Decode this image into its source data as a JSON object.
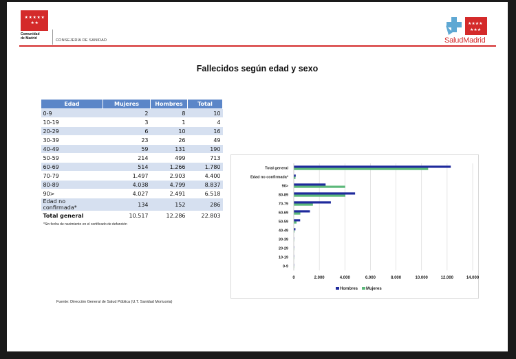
{
  "header": {
    "logo_left_line1": "Comunidad",
    "logo_left_line2": "de Madrid",
    "consejeria": "CONSEJERÍA DE SANIDAD",
    "logo_right": "SaludMadrid"
  },
  "title": "Fallecidos según edad y sexo",
  "table": {
    "headers": [
      "Edad",
      "Mujeres",
      "Hombres",
      "Total"
    ],
    "rows": [
      [
        "0-9",
        "2",
        "8",
        "10"
      ],
      [
        "10-19",
        "3",
        "1",
        "4"
      ],
      [
        "20-29",
        "6",
        "10",
        "16"
      ],
      [
        "30-39",
        "23",
        "26",
        "49"
      ],
      [
        "40-49",
        "59",
        "131",
        "190"
      ],
      [
        "50-59",
        "214",
        "499",
        "713"
      ],
      [
        "60-69",
        "514",
        "1.266",
        "1.780"
      ],
      [
        "70-79",
        "1.497",
        "2.903",
        "4.400"
      ],
      [
        "80-89",
        "4.038",
        "4.799",
        "8.837"
      ],
      [
        "90>",
        "4.027",
        "2.491",
        "6.518"
      ],
      [
        "Edad no confirmada*",
        "134",
        "152",
        "286"
      ]
    ],
    "total": [
      "Total general",
      "10.517",
      "12.286",
      "22.803"
    ]
  },
  "footnote": "*Sin fecha de nacimiento en el certificado de defunción",
  "source": "Fuente: Dirección General de Salud Pública (U.T. Sanidad Mortuoria)",
  "colors": {
    "hombres": "#1f2a9c",
    "mujeres": "#5cb87a",
    "header_blue": "#5b86c8",
    "brand_red": "#d42a2a"
  },
  "chart_data": {
    "type": "bar",
    "orientation": "horizontal",
    "categories": [
      "Total general",
      "Edad no confirmada*",
      "90>",
      "80-89",
      "70-79",
      "60-69",
      "50-59",
      "40-49",
      "30-39",
      "20-29",
      "10-19",
      "0-9"
    ],
    "series": [
      {
        "name": "Hombres",
        "values": [
          12286,
          152,
          2491,
          4799,
          2903,
          1266,
          499,
          131,
          26,
          10,
          1,
          8
        ]
      },
      {
        "name": "Mujeres",
        "values": [
          10517,
          134,
          4027,
          4038,
          1497,
          514,
          214,
          59,
          23,
          6,
          3,
          2
        ]
      }
    ],
    "xlim": [
      0,
      14000
    ],
    "xticks": [
      "0",
      "2.000",
      "4.000",
      "6.000",
      "8.000",
      "10.000",
      "12.000",
      "14.000"
    ],
    "grid": true,
    "legend": "bottom"
  }
}
